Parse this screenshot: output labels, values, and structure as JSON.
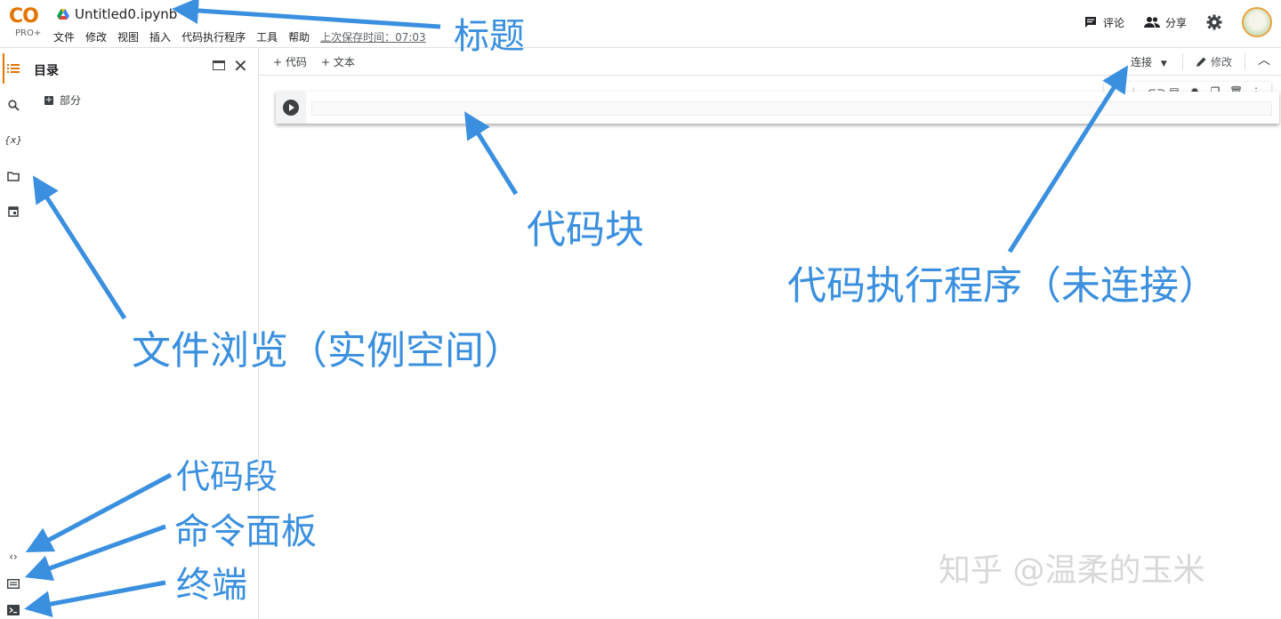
{
  "app": {
    "logo_text": "CO",
    "logo_badge": "PRO+",
    "notebook_title": "Untitled0.ipynb",
    "menu": [
      "文件",
      "修改",
      "视图",
      "插入",
      "代码执行程序",
      "工具",
      "帮助"
    ],
    "last_saved": "上次保存时间：07:03",
    "comment_label": "评论",
    "share_label": "分享"
  },
  "toc": {
    "title": "目录",
    "section_label": "部分"
  },
  "toolbar": {
    "add_code": "+ 代码",
    "add_text": "+ 文本",
    "connect": "连接",
    "edit": "修改"
  },
  "sidebar_icons": [
    "toc-icon",
    "search-icon",
    "variables-icon",
    "folder-icon",
    "calendar-icon",
    "code-snippets-icon",
    "command-palette-icon",
    "terminal-icon"
  ],
  "annotations": {
    "title": "标题",
    "code_cell": "代码块",
    "runtime": "代码执行程序（未连接）",
    "file_browser": "文件浏览（实例空间）",
    "snippets": "代码段",
    "command_palette": "命令面板",
    "terminal": "终端"
  },
  "watermark": "知乎 @温柔的玉米",
  "colors": {
    "annotation_blue": "#3a8fdf",
    "logo_orange": "#e37400",
    "logo_yellow": "#f9ab00"
  }
}
